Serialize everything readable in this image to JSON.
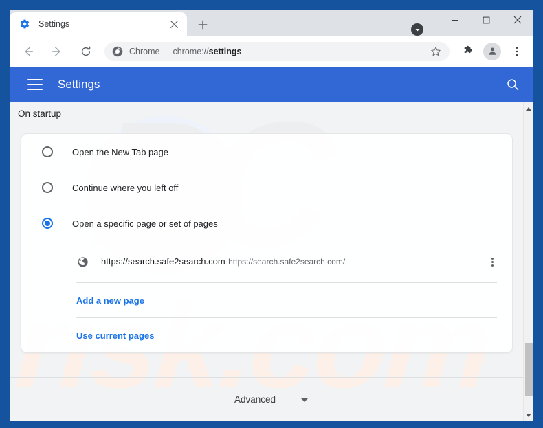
{
  "window": {
    "frame_color": "#15539e",
    "tabstrip_color": "#dee1e6",
    "download_badge_icon": "download-chevron-icon",
    "minimize_label": "─",
    "maximize_label": "□",
    "close_label": "✕"
  },
  "tab": {
    "favicon": "settings-gear-icon",
    "title": "Settings",
    "close_icon": "close-icon",
    "new_tab_icon": "plus-icon"
  },
  "toolbar": {
    "back_icon": "arrow-left-icon",
    "forward_icon": "arrow-right-icon",
    "reload_icon": "reload-icon",
    "omnibox": {
      "site_icon": "chrome-logo-icon",
      "chip_label": "Chrome",
      "url_prefix": "chrome://",
      "url_bold": "settings",
      "star_icon": "star-icon"
    },
    "extensions_icon": "puzzle-icon",
    "profile_icon": "person-avatar-icon",
    "menu_icon": "three-dot-menu-icon"
  },
  "settings_header": {
    "menu_icon": "hamburger-menu-icon",
    "title": "Settings",
    "search_icon": "search-icon",
    "background_color": "#3267d6"
  },
  "content": {
    "section_title": "On startup",
    "startup_options": [
      {
        "label": "Open the New Tab page",
        "selected": false
      },
      {
        "label": "Continue where you left off",
        "selected": false
      },
      {
        "label": "Open a specific page or set of pages",
        "selected": true
      }
    ],
    "startup_pages": [
      {
        "icon": "globe-icon",
        "title": "https://search.safe2search.com",
        "subtitle": "https://search.safe2search.com/",
        "menu_icon": "three-dot-menu-icon"
      }
    ],
    "links": [
      {
        "label": "Add a new page"
      },
      {
        "label": "Use current pages"
      }
    ],
    "advanced": {
      "label": "Advanced",
      "caret_icon": "chevron-down-icon"
    },
    "watermark": {
      "primary": "PC",
      "secondary": "risk.com"
    },
    "accent_color": "#1a73e8"
  },
  "scrollbar": {
    "up_icon": "triangle-up-icon",
    "down_icon": "triangle-down-icon"
  }
}
